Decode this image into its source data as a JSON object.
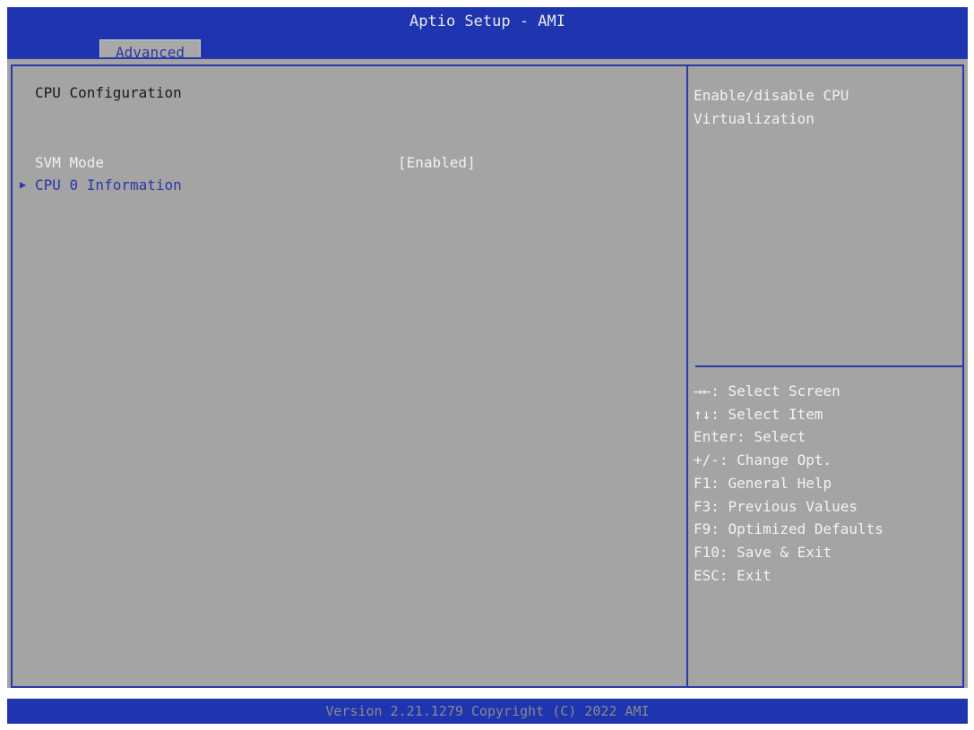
{
  "app": {
    "title": "Aptio Setup - AMI"
  },
  "tabs": [
    {
      "label": "Advanced"
    }
  ],
  "page": {
    "section_title": "CPU Configuration",
    "options": [
      {
        "label": "SVM Mode",
        "value": "[Enabled]"
      }
    ],
    "submenus": [
      {
        "label": "CPU 0 Information",
        "icon": "triangle-right-icon"
      }
    ]
  },
  "help": {
    "lines": [
      "Enable/disable CPU",
      "Virtualization"
    ]
  },
  "keys": [
    "→←: Select Screen",
    "↑↓: Select Item",
    "Enter: Select",
    "+/-: Change Opt.",
    "F1: General Help",
    "F3: Previous Values",
    "F9: Optimized Defaults",
    "F10: Save & Exit",
    "ESC: Exit"
  ],
  "footer": {
    "text": "Version 2.21.1279 Copyright (C) 2022 AMI"
  },
  "colors": {
    "header_blue": "#1f35b0",
    "panel_gray": "#a4a4a4",
    "accent_blue": "#2a38a8"
  }
}
